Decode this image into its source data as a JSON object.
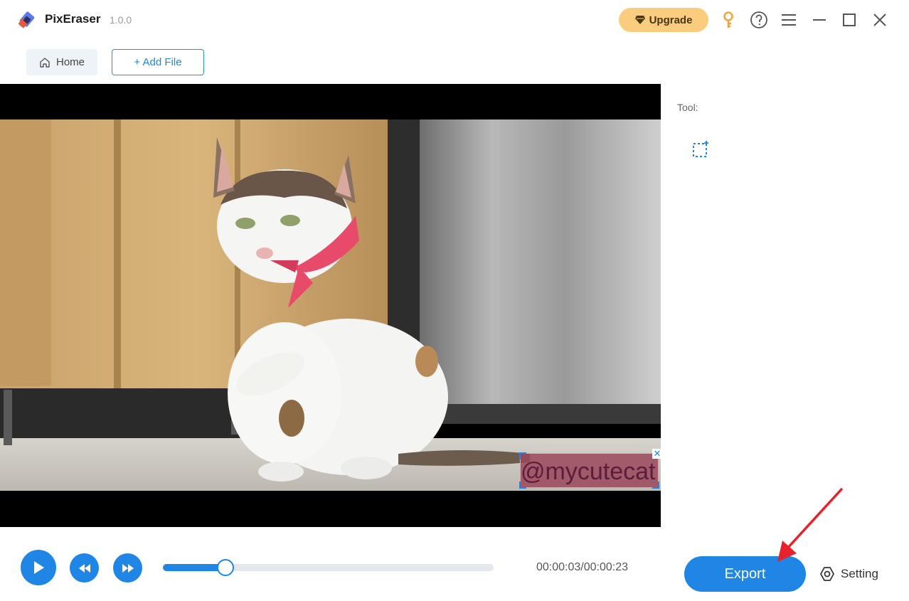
{
  "app": {
    "name": "PixEraser",
    "version": "1.0.0"
  },
  "header": {
    "upgrade_label": "Upgrade",
    "icons": [
      "diamond-icon",
      "key-icon",
      "help-icon",
      "menu-icon",
      "minimize-icon",
      "maximize-icon",
      "close-icon"
    ]
  },
  "nav": {
    "home_label": "Home",
    "add_file_label": "+ Add File"
  },
  "watermark": {
    "text": "@mycutecat"
  },
  "sidebar": {
    "tool_label": "Tool:",
    "tools": [
      "rect-select-icon"
    ]
  },
  "player": {
    "time_display": "00:00:03/00:00:23",
    "progress": 0.19
  },
  "actions": {
    "export_label": "Export",
    "setting_label": "Setting"
  },
  "colors": {
    "accent": "#1f86e6",
    "upgrade": "#f9cd7d",
    "key": "#f2a43a",
    "annotation": "#e8222a"
  }
}
